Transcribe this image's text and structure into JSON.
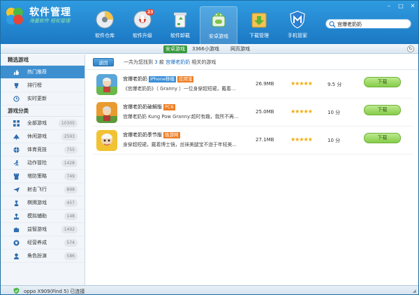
{
  "app": {
    "title": "软件管理",
    "slogan": "海量软件 轻松管理"
  },
  "nav": [
    {
      "label": "软件仓库",
      "icon": "disc-icon"
    },
    {
      "label": "软件升级",
      "icon": "upgrade-icon",
      "badge": "23"
    },
    {
      "label": "软件卸载",
      "icon": "recycle-bin-icon"
    },
    {
      "label": "安卓游戏",
      "icon": "android-game-icon",
      "active": true
    },
    {
      "label": "下载管理",
      "icon": "download-icon"
    },
    {
      "label": "手机管家",
      "icon": "shield-icon"
    }
  ],
  "search": {
    "value": "宫爆老奶奶"
  },
  "subtabs": [
    {
      "label": "安卓游戏",
      "active": true
    },
    {
      "label": "3366小游戏"
    },
    {
      "label": "网页游戏"
    }
  ],
  "sidebar": {
    "section1": "精选游戏",
    "featured": [
      {
        "label": "热门推荐",
        "icon": "thumb-icon",
        "active": true
      },
      {
        "label": "排行榜",
        "icon": "trophy-icon"
      },
      {
        "label": "实时更新",
        "icon": "clock-icon"
      }
    ],
    "section2": "游戏分类",
    "categories": [
      {
        "label": "全部游戏",
        "count": "10305",
        "icon": "grid-icon"
      },
      {
        "label": "休闲游戏",
        "count": "2593",
        "icon": "leisure-icon"
      },
      {
        "label": "体育竞技",
        "count": "755",
        "icon": "ball-icon"
      },
      {
        "label": "动作冒险",
        "count": "1428",
        "icon": "runner-icon"
      },
      {
        "label": "塔防策略",
        "count": "749",
        "icon": "tower-icon"
      },
      {
        "label": "射击飞行",
        "count": "898",
        "icon": "plane-icon"
      },
      {
        "label": "棋牌游戏",
        "count": "457",
        "icon": "chess-icon"
      },
      {
        "label": "模拟辅助",
        "count": "148",
        "icon": "joystick-icon"
      },
      {
        "label": "益智游戏",
        "count": "1492",
        "icon": "puzzle-icon"
      },
      {
        "label": "经营养成",
        "count": "574",
        "icon": "shop-icon"
      },
      {
        "label": "角色扮演",
        "count": "586",
        "icon": "role-icon"
      }
    ]
  },
  "breadcrumb": {
    "back": "返回",
    "prefix": "一共为您找到",
    "count": "3",
    "mid": "款",
    "query": "宫爆老奶奶",
    "suffix": "相关的游戏"
  },
  "results": [
    {
      "name": "宫爆老奶奶",
      "tag": "iPhone移植",
      "tag_color": "#3a8fd8",
      "tag2": "应用宝",
      "tag2_color": "#ef7d22",
      "desc": "《宫爆老奶奶》（ Granny ）一位身穿超短裙，戴着...",
      "size": "26.9MB",
      "stars": "★★★★★",
      "score": "9.5 分",
      "download": "下载"
    },
    {
      "name": "宫爆老奶奶破解版",
      "tag": "PC6",
      "tag_color": "#ef7d22",
      "desc": "宫爆老奶奶 Kung Pow Granny:超时有趣，我所不再...",
      "size": "25.0MB",
      "stars": "★★★★★",
      "score": "10 分",
      "download": "下载"
    },
    {
      "name": "宫爆老奶奶季节版",
      "tag": "极游网",
      "tag_color": "#ef7d22",
      "desc": "身穿超短裙，戴着博士镜，丝袜美腿宝不逊于年轻美...",
      "size": "27.1MB",
      "stars": "★★★★★",
      "score": "10 分",
      "download": "下载"
    }
  ],
  "status": {
    "text": "oppo X909(Find 5)  已连接"
  }
}
